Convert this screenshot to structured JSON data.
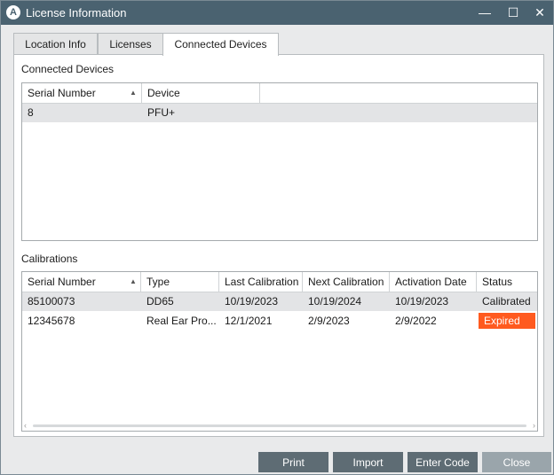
{
  "window": {
    "title": "License Information",
    "app_icon_letter": "A",
    "minimize_glyph": "—",
    "maximize_glyph": "☐",
    "close_glyph": "✕"
  },
  "tabs": [
    {
      "label": "Location Info",
      "active": false
    },
    {
      "label": "Licenses",
      "active": false
    },
    {
      "label": "Connected Devices",
      "active": true
    }
  ],
  "connected_devices": {
    "section_label": "Connected Devices",
    "columns": [
      "Serial Number",
      "Device"
    ],
    "rows": [
      {
        "serial": "8",
        "device": "PFU+"
      }
    ]
  },
  "calibrations": {
    "section_label": "Calibrations",
    "columns": [
      "Serial Number",
      "Type",
      "Last Calibration",
      "Next Calibration",
      "Activation Date",
      "Status"
    ],
    "rows": [
      {
        "serial": "85100073",
        "type": "DD65",
        "last": "10/19/2023",
        "next": "10/19/2024",
        "activation": "10/19/2023",
        "status": "Calibrated"
      },
      {
        "serial": "12345678",
        "type": "Real Ear Pro...",
        "last": "12/1/2021",
        "next": "2/9/2023",
        "activation": "2/9/2022",
        "status": "Expired"
      }
    ]
  },
  "buttons": {
    "print": "Print",
    "import": "Import",
    "enter_code": "Enter Code",
    "close": "Close"
  },
  "colors": {
    "titlebar": "#4a6270",
    "expired": "#ff5a1f",
    "button": "#5e6c74",
    "button_disabled": "#9aa5ab"
  }
}
